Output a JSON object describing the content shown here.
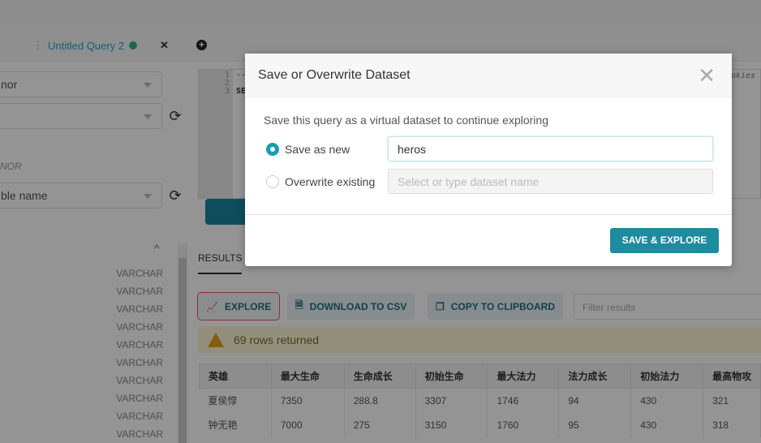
{
  "tab": {
    "title": "Untitled Query 2",
    "status_color": "#2fb36e"
  },
  "sidebar": {
    "database_select": "nor",
    "schema_select": "",
    "section_label": "NOR",
    "table_select_placeholder": "ble name",
    "column_types": [
      "VARCHAR",
      "VARCHAR",
      "VARCHAR",
      "VARCHAR",
      "VARCHAR",
      "VARCHAR",
      "VARCHAR",
      "VARCHAR",
      "VARCHAR",
      "VARCHAR"
    ]
  },
  "editor": {
    "line_numbers": [
      "1",
      "2",
      "3"
    ],
    "lines": [
      "--",
      "",
      "SE"
    ],
    "trailing_text": "ookies"
  },
  "results": {
    "tab_label": "RESULTS",
    "explore": "EXPLORE",
    "download": "DOWNLOAD TO CSV",
    "copy": "COPY TO CLIPBOARD",
    "filter_placeholder": "Filter results",
    "alert": "69 rows returned",
    "columns": [
      "英雄",
      "最大生命",
      "生命成长",
      "初始生命",
      "最大法力",
      "法力成长",
      "初始法力",
      "最高物攻"
    ],
    "rows": [
      [
        "夏侯惇",
        "7350",
        "288.8",
        "3307",
        "1746",
        "94",
        "430",
        "321"
      ],
      [
        "钟无艳",
        "7000",
        "275",
        "3150",
        "1760",
        "95",
        "430",
        "318"
      ]
    ]
  },
  "modal": {
    "title": "Save or Overwrite Dataset",
    "intro": "Save this query as a virtual dataset to continue exploring",
    "save_new_label": "Save as new",
    "dataset_name": "heros",
    "overwrite_label": "Overwrite existing",
    "overwrite_placeholder": "Select or type dataset name",
    "save_button": "SAVE & EXPLORE",
    "accent": "#1f8b9f"
  }
}
